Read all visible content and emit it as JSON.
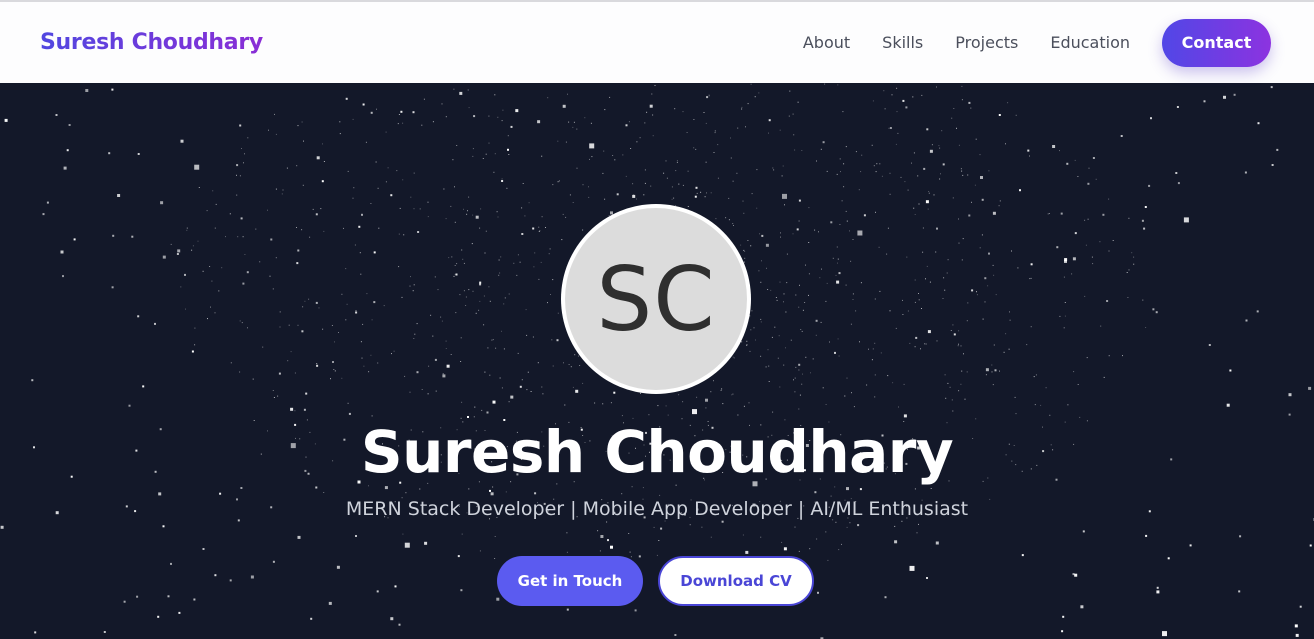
{
  "nav": {
    "brand": "Suresh Choudhary",
    "links": [
      "About",
      "Skills",
      "Projects",
      "Education"
    ],
    "contact_label": "Contact"
  },
  "hero": {
    "avatar_initials": "SC",
    "name": "Suresh Choudhary",
    "tagline": "MERN Stack Developer | Mobile App Developer | AI/ML Enthusiast",
    "primary_button": "Get in Touch",
    "secondary_button": "Download CV"
  },
  "colors": {
    "hero_background": "#131829",
    "brand_gradient_start": "#5147e0",
    "brand_gradient_end": "#8a2ed6",
    "primary_button": "#5b5bf0"
  }
}
